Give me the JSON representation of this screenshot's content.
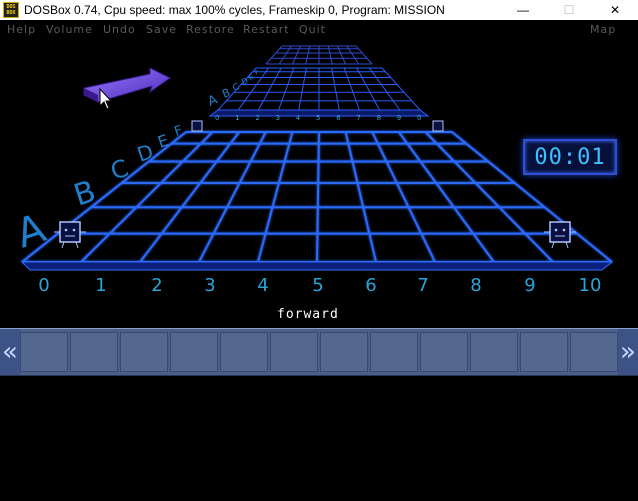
{
  "window": {
    "title": "DOSBox 0.74, Cpu speed: max 100% cycles, Frameskip  0, Program:  MISSION",
    "app_icon_text": "DOS BOX",
    "minimize_glyph": "—",
    "maximize_glyph": "☐",
    "close_glyph": "✕"
  },
  "menu": {
    "items": [
      "Help",
      "Volume",
      "Undo",
      "Save",
      "Restore",
      "Restart",
      "Quit"
    ],
    "map": "Map",
    "color": "#5a5a5a"
  },
  "game": {
    "x_numbers": [
      "0",
      "1",
      "2",
      "3",
      "4",
      "5",
      "6",
      "7",
      "8",
      "9",
      "10"
    ],
    "far_numbers": [
      "0",
      "1",
      "2",
      "3",
      "4",
      "5",
      "6",
      "7",
      "8",
      "9",
      "0"
    ],
    "row_letters_big": "ABCDEF",
    "row_letters_far": "ABCDEF",
    "timer": "00:01",
    "caption": "forward",
    "strip_left_arrow": "«",
    "strip_right_arrow": "»",
    "grid_color": "#2a5bff",
    "number_color": "#2aa4d8"
  }
}
